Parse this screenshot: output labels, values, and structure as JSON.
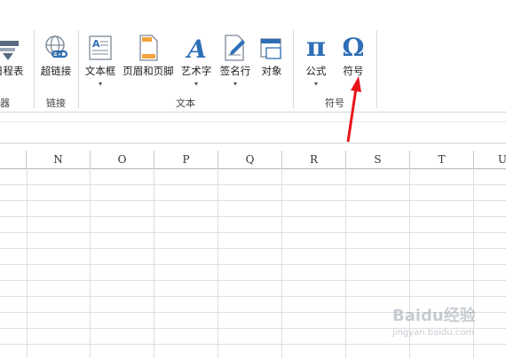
{
  "ribbon": {
    "partial_left": {
      "label": "日程表",
      "group": "器"
    },
    "groups": [
      {
        "name": "链接",
        "items": [
          {
            "label": "超链接",
            "icon": "hyperlink-icon"
          }
        ]
      },
      {
        "name": "文本",
        "items": [
          {
            "label": "文本框",
            "icon": "textbox-icon",
            "dropdown": "▾"
          },
          {
            "label": "页眉和页脚",
            "icon": "header-footer-icon"
          },
          {
            "label": "艺术字",
            "icon": "wordart-icon",
            "dropdown": "▾"
          },
          {
            "label": "签名行",
            "icon": "signature-line-icon",
            "dropdown": "▾"
          },
          {
            "label": "对象",
            "icon": "object-icon"
          }
        ]
      },
      {
        "name": "符号",
        "items": [
          {
            "label": "公式",
            "icon": "pi-icon",
            "glyph": "π",
            "dropdown": "▾"
          },
          {
            "label": "符号",
            "icon": "omega-icon",
            "glyph": "Ω"
          }
        ]
      }
    ]
  },
  "sheet": {
    "columns": [
      "N",
      "O",
      "P",
      "Q",
      "R",
      "S",
      "T",
      "U"
    ]
  },
  "watermark": {
    "brand": "Baidu经验",
    "url": "jingyan.baidu.com"
  },
  "colors": {
    "accent_blue": "#2e6eb5",
    "arrow_red": "#e8141a"
  }
}
